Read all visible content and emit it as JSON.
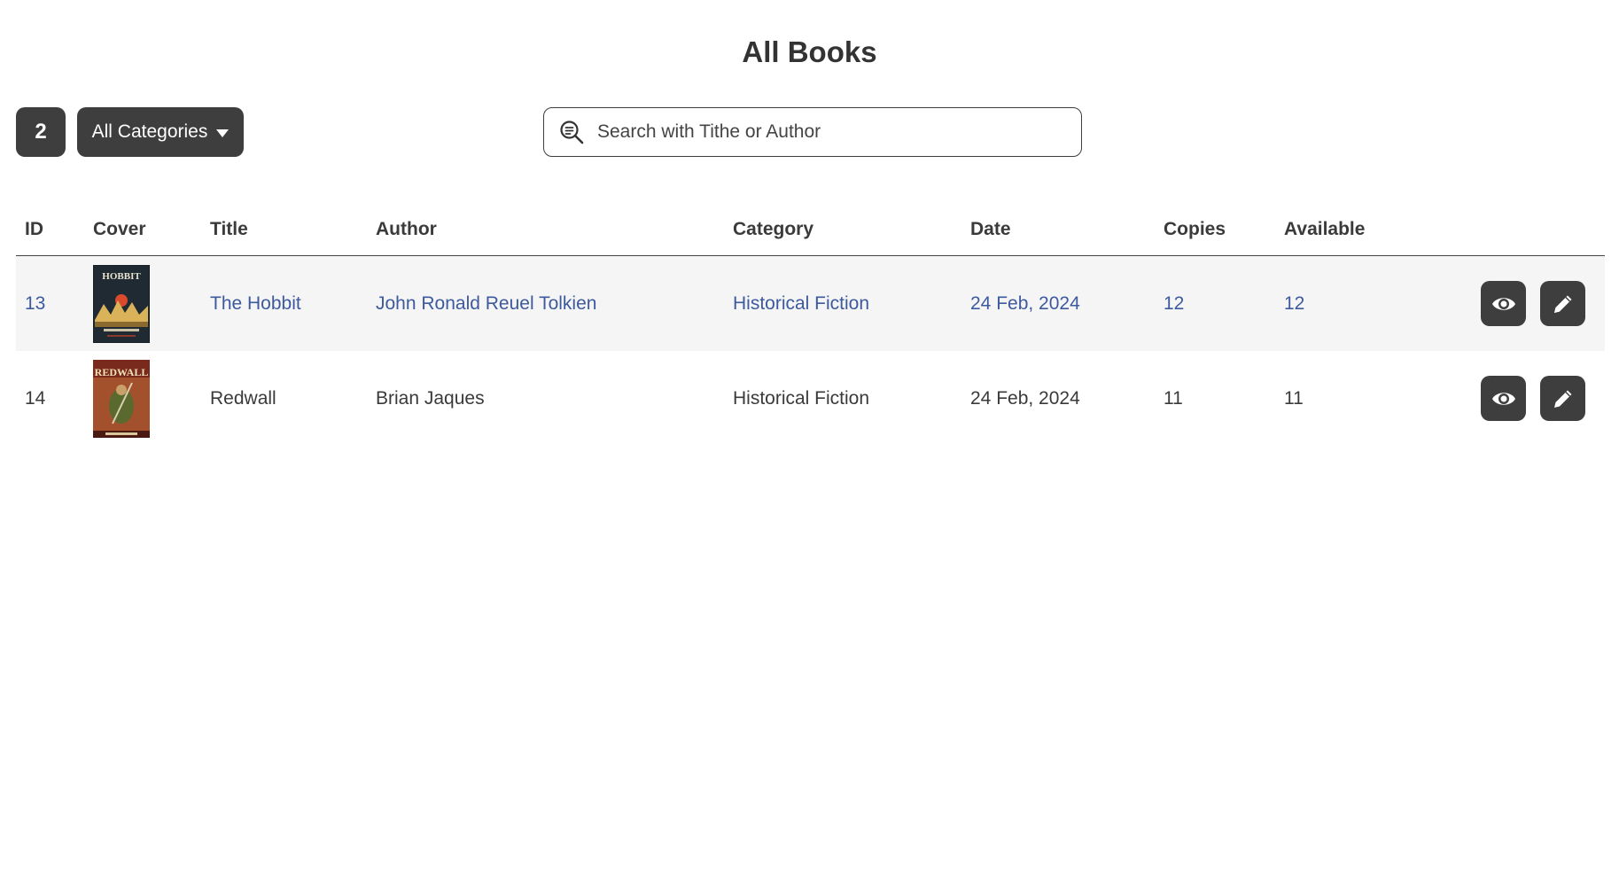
{
  "page": {
    "title": "All Books"
  },
  "toolbar": {
    "count": "2",
    "category_label": "All Categories",
    "search_placeholder": "Search with Tithe or Author"
  },
  "table": {
    "headers": [
      "ID",
      "Cover",
      "Title",
      "Author",
      "Category",
      "Date",
      "Copies",
      "Available"
    ],
    "rows": [
      {
        "id": "13",
        "cover": "The Hobbit cover",
        "title": "The Hobbit",
        "author": "John Ronald Reuel Tolkien",
        "category": "Historical Fiction",
        "date": "24 Feb, 2024",
        "copies": "12",
        "available": "12"
      },
      {
        "id": "14",
        "cover": "Redwall cover",
        "title": "Redwall",
        "author": "Brian Jaques",
        "category": "Historical Fiction",
        "date": "24 Feb, 2024",
        "copies": "11",
        "available": "11"
      }
    ]
  },
  "icons": {
    "search": "search-icon",
    "view": "eye-icon",
    "edit": "pencil-icon",
    "dropdown": "caret-down-icon"
  },
  "colors": {
    "button_bg": "#3e3e3e",
    "highlight_text": "#3d5a9e",
    "highlight_row_bg": "#f5f5f5"
  }
}
